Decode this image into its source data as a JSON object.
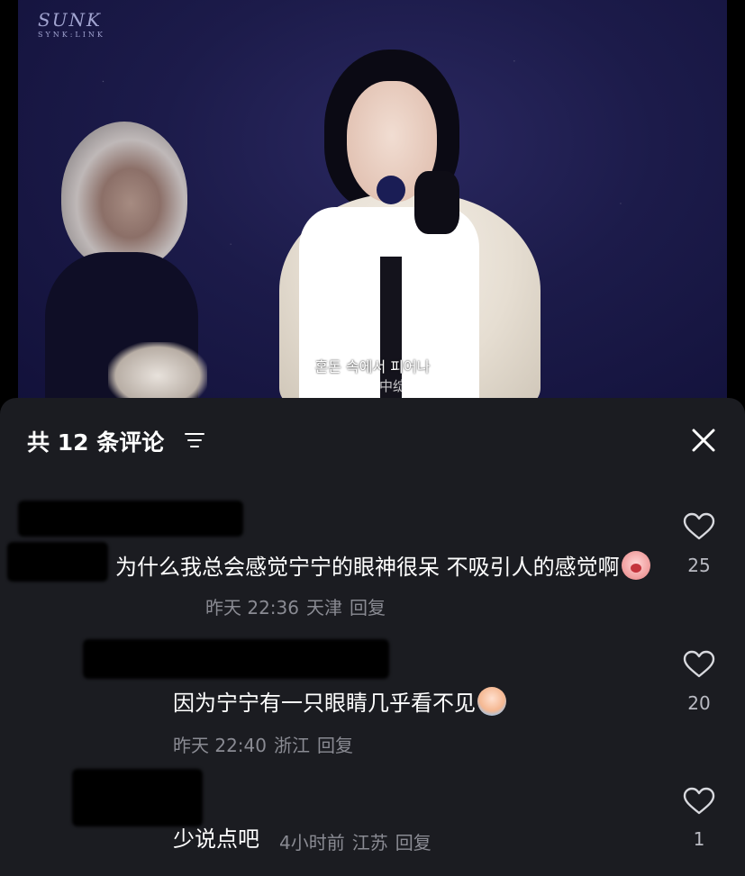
{
  "video": {
    "logo_main": "SUNK",
    "logo_sub": "SYNK:LINK",
    "subtitle_line1": "혼돈 속에서 피어나",
    "subtitle_line2": "于混沌之中绽放"
  },
  "comments_panel": {
    "title": "共 12 条评论",
    "filter_icon": "filter-icon",
    "close_icon": "close-icon",
    "comments": [
      {
        "text": "为什么我总会感觉宁宁的眼神很呆 不吸引人的感觉啊",
        "emoji": "crying-face-emoji",
        "time": "昨天 22:36",
        "location": "天津",
        "reply_label": "回复",
        "likes": "25"
      },
      {
        "text": "因为宁宁有一只眼睛几乎看不见",
        "emoji": "sad-face-emoji",
        "time": "昨天 22:40",
        "location": "浙江",
        "reply_label": "回复",
        "likes": "20"
      },
      {
        "text": "少说点吧",
        "time": "4小时前",
        "location": "江苏",
        "reply_label": "回复",
        "likes": "1"
      }
    ]
  }
}
